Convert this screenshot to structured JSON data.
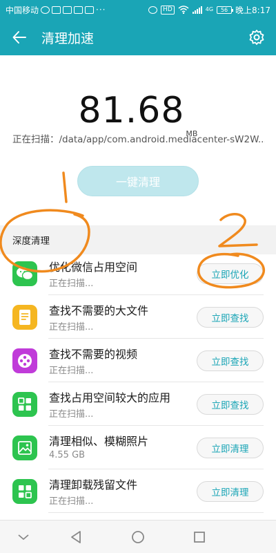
{
  "status_bar": {
    "carrier": "中国移动",
    "overflow": "···",
    "network_badge": "4G",
    "signal_badge": "HD",
    "battery": "56",
    "time": "晚上8:17"
  },
  "app_bar": {
    "title": "清理加速"
  },
  "summary": {
    "size_value": "81.68",
    "size_unit": "MB",
    "scan_path": "正在扫描：/data/app/com.android.mediacenter-sW2W..."
  },
  "clean_button": {
    "label": "一键清理"
  },
  "section": {
    "title": "深度清理"
  },
  "items": [
    {
      "title": "优化微信占用空间",
      "subtitle": "正在扫描...",
      "button": "立即优化",
      "icon": "wechat-icon",
      "color": "#2dc44f"
    },
    {
      "title": "查找不需要的大文件",
      "subtitle": "正在扫描...",
      "button": "立即查找",
      "icon": "document-icon",
      "color": "#f5b621"
    },
    {
      "title": "查找不需要的视频",
      "subtitle": "正在扫描...",
      "button": "立即查找",
      "icon": "video-reel-icon",
      "color": "#c03bd9"
    },
    {
      "title": "查找占用空间较大的应用",
      "subtitle": "正在扫描...",
      "button": "立即查找",
      "icon": "apps-grid-icon",
      "color": "#2dc44f"
    },
    {
      "title": "清理相似、模糊照片",
      "subtitle": "4.55 GB",
      "button": "立即清理",
      "icon": "photo-icon",
      "color": "#2dc44f"
    },
    {
      "title": "清理卸载残留文件",
      "subtitle": "正在扫描...",
      "button": "立即清理",
      "icon": "apps-grid-icon",
      "color": "#2dc44f"
    }
  ],
  "annotations": {
    "label_1": "1",
    "label_2": "2"
  },
  "colors": {
    "accent": "#1aa5b6",
    "annotation": "#f08a1e"
  }
}
